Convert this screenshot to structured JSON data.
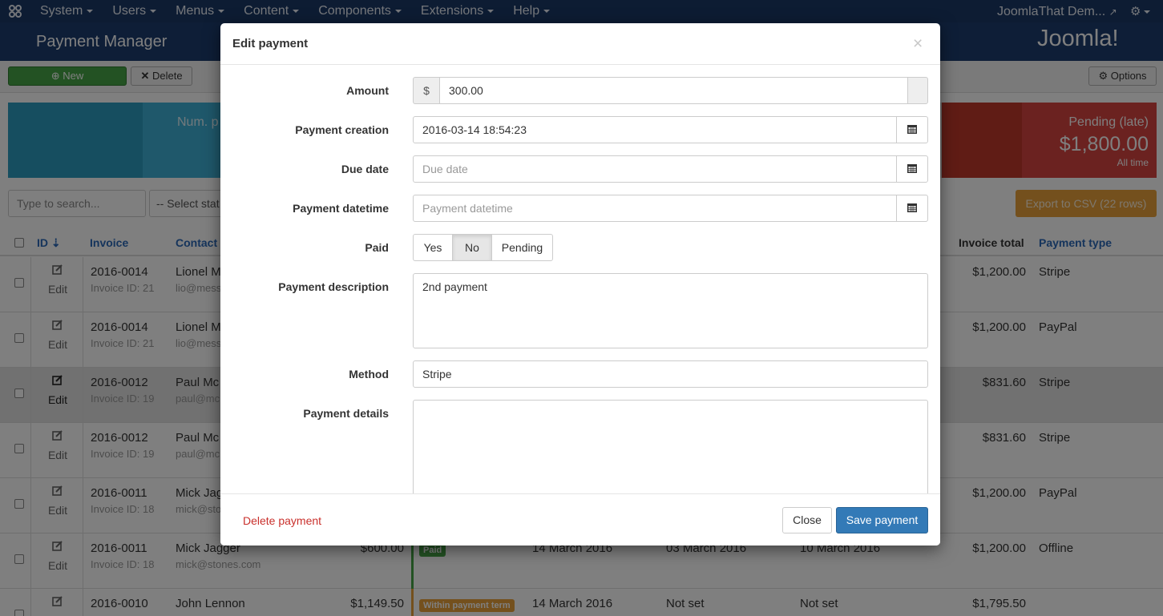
{
  "topbar": {
    "menu": [
      "System",
      "Users",
      "Menus",
      "Content",
      "Components",
      "Extensions",
      "Help"
    ],
    "site_link": "JoomlaThat Dem..."
  },
  "header": {
    "title": "Payment Manager",
    "logo_text": "Joomla!"
  },
  "toolbar": {
    "new_label": "New",
    "delete_label": "Delete",
    "options_label": "Options"
  },
  "stats": {
    "num_label": "Num. p",
    "late_label": "Pending (late)",
    "late_value": "$1,800.00",
    "late_period": "All time"
  },
  "filters": {
    "search_placeholder": "Type to search...",
    "status_select": "-- Select stat",
    "export_label": "Export to CSV (22 rows)"
  },
  "table": {
    "headers": {
      "id": "ID",
      "invoice": "Invoice",
      "contact": "Contact",
      "invoice_total": "Invoice total",
      "payment_type": "Payment type"
    },
    "edit_label": "Edit",
    "rows": [
      {
        "invoice": "2016-0014",
        "invoice_id": "Invoice ID: 21",
        "contact": "Lionel M",
        "email": "lio@mess",
        "total": "$1,200.00",
        "type": "Stripe"
      },
      {
        "invoice": "2016-0014",
        "invoice_id": "Invoice ID: 21",
        "contact": "Lionel M",
        "email": "lio@mess",
        "total": "$1,200.00",
        "type": "PayPal"
      },
      {
        "invoice": "2016-0012",
        "invoice_id": "Invoice ID: 19",
        "contact": "Paul Mc",
        "email": "paul@mc",
        "total": "$831.60",
        "type": "Stripe"
      },
      {
        "invoice": "2016-0012",
        "invoice_id": "Invoice ID: 19",
        "contact": "Paul Mc",
        "email": "paul@mc",
        "total": "$831.60",
        "type": "Stripe"
      },
      {
        "invoice": "2016-0011",
        "invoice_id": "Invoice ID: 18",
        "contact": "Mick Jag",
        "email": "mick@sto",
        "total": "$1,200.00",
        "type": "PayPal"
      },
      {
        "invoice": "2016-0011",
        "invoice_id": "Invoice ID: 18",
        "contact": "Mick Jagger",
        "email": "mick@stones.com",
        "amount": "$600.00",
        "badge": "Paid",
        "date1": "14 March 2016",
        "date2": "03 March 2016",
        "date3": "10 March 2016",
        "total": "$1,200.00",
        "type": "Offline"
      },
      {
        "invoice": "2016-0010",
        "invoice_id": "",
        "contact": "John Lennon",
        "email": "",
        "amount": "$1,149.50",
        "badge": "Within payment term",
        "date1": "14 March 2016",
        "date2": "Not set",
        "date3": "Not set",
        "total": "$1,795.50",
        "type": ""
      }
    ]
  },
  "modal": {
    "title": "Edit payment",
    "close_x": "×",
    "amount_label": "Amount",
    "currency": "$",
    "amount_value": "300.00",
    "creation_label": "Payment creation",
    "creation_value": "2016-03-14 18:54:23",
    "due_label": "Due date",
    "due_placeholder": "Due date",
    "datetime_label": "Payment datetime",
    "datetime_placeholder": "Payment datetime",
    "paid_label": "Paid",
    "paid_options": [
      "Yes",
      "No",
      "Pending"
    ],
    "paid_selected": "No",
    "desc_label": "Payment description",
    "desc_value": "2nd payment",
    "method_label": "Method",
    "method_value": "Stripe",
    "details_label": "Payment details",
    "details_value": "",
    "delete_label": "Delete payment",
    "close_label": "Close",
    "save_label": "Save payment"
  },
  "colors": {
    "topbar": "#1a3867",
    "header": "#1c3d6e",
    "new_button": "#46a546",
    "save_button": "#337ab7",
    "delete_link": "#c9302c",
    "paid_badge": "#46a546",
    "term_badge": "#e8a03a",
    "export_button": "#e8a03a"
  },
  "icons": {
    "menu_logo": "joomla-icon",
    "options": "gear-icon",
    "edit": "edit-icon",
    "calendar": "calendar-icon",
    "new": "plus-circle-icon",
    "delete": "x-icon",
    "external": "external-link-icon"
  }
}
